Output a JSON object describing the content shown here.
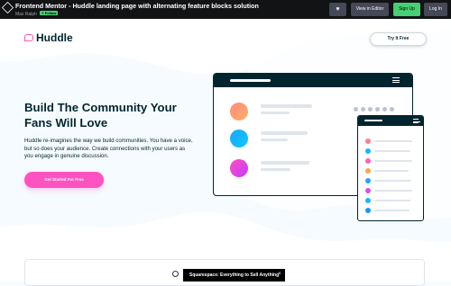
{
  "topbar": {
    "title": "Frontend Mentor - Huddle landing page with alternating feature blocks solution",
    "author": "Max Ralph",
    "badge": "+ Follow",
    "heart_icon": "heart-icon",
    "view_editor_label": "View in Editor",
    "sign_up_label": "Sign Up",
    "log_in_label": "Log In"
  },
  "page": {
    "logo_text": "Huddle",
    "try_button_label": "Try It Free",
    "headline": "Build The Community Your Fans Will Love",
    "description": "Huddle re-imagines the way we build communities. You have a voice, but so does your audience. Create connections with your users as you engage in genuine discussion.",
    "cta_label": "Get Started For Free",
    "colors": {
      "navy": "#00252e",
      "pink": "#ff52c1",
      "background": "#f6fbff"
    }
  },
  "ad": {
    "text": "Squarespace: Everything to Sell Anything"
  }
}
